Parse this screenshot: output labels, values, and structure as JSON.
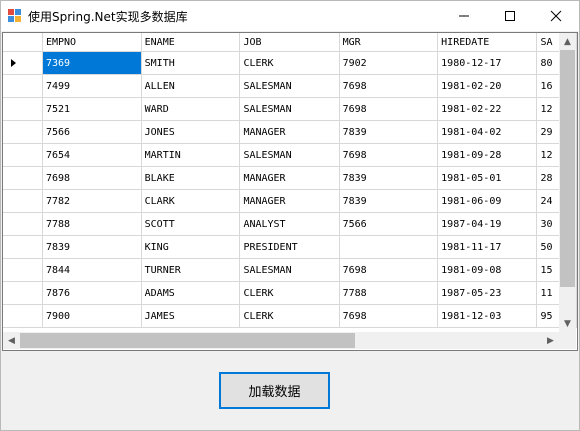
{
  "window": {
    "title": "使用Spring.Net实现多数据库"
  },
  "grid": {
    "columns": [
      "EMPNO",
      "ENAME",
      "JOB",
      "MGR",
      "HIREDATE",
      "SA"
    ],
    "rows": [
      [
        "7369",
        "SMITH",
        "CLERK",
        "7902",
        "1980-12-17",
        "80"
      ],
      [
        "7499",
        "ALLEN",
        "SALESMAN",
        "7698",
        "1981-02-20",
        "16"
      ],
      [
        "7521",
        "WARD",
        "SALESMAN",
        "7698",
        "1981-02-22",
        "12"
      ],
      [
        "7566",
        "JONES",
        "MANAGER",
        "7839",
        "1981-04-02",
        "29"
      ],
      [
        "7654",
        "MARTIN",
        "SALESMAN",
        "7698",
        "1981-09-28",
        "12"
      ],
      [
        "7698",
        "BLAKE",
        "MANAGER",
        "7839",
        "1981-05-01",
        "28"
      ],
      [
        "7782",
        "CLARK",
        "MANAGER",
        "7839",
        "1981-06-09",
        "24"
      ],
      [
        "7788",
        "SCOTT",
        "ANALYST",
        "7566",
        "1987-04-19",
        "30"
      ],
      [
        "7839",
        "KING",
        "PRESIDENT",
        "",
        "1981-11-17",
        "50"
      ],
      [
        "7844",
        "TURNER",
        "SALESMAN",
        "7698",
        "1981-09-08",
        "15"
      ],
      [
        "7876",
        "ADAMS",
        "CLERK",
        "7788",
        "1987-05-23",
        "11"
      ],
      [
        "7900",
        "JAMES",
        "CLERK",
        "7698",
        "1981-12-03",
        "95"
      ]
    ]
  },
  "button": {
    "load_label": "加载数据"
  },
  "colors": {
    "selection": "#0078d7",
    "button_border": "#0078d7"
  }
}
